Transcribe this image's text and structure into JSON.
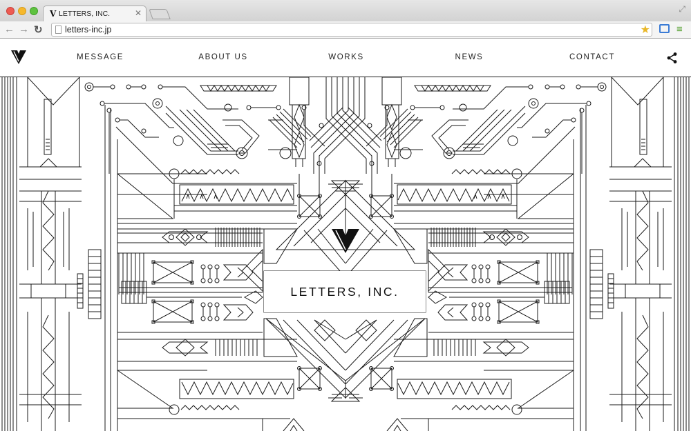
{
  "browser": {
    "tab_title": "LETTERS, INC.",
    "tab_favicon": "V",
    "url": "letters-inc.jp",
    "icons": [
      "close-icon",
      "back-icon",
      "forward-icon",
      "reload-icon",
      "page-icon",
      "star-icon",
      "cast-icon",
      "menu-icon",
      "fullscreen-icon"
    ]
  },
  "site": {
    "logo_icon": "v-monogram-icon",
    "nav": [
      {
        "label": "MESSAGE"
      },
      {
        "label": "ABOUT US"
      },
      {
        "label": "WORKS"
      },
      {
        "label": "NEWS"
      },
      {
        "label": "CONTACT"
      }
    ],
    "share_icon": "share-icon"
  },
  "hero": {
    "title": "LETTERS, INC."
  },
  "colors": {
    "line": "#1a1a1a",
    "background": "#ffffff",
    "star": "#e9b728",
    "cast": "#3a7bd5",
    "menu": "#55a030"
  }
}
